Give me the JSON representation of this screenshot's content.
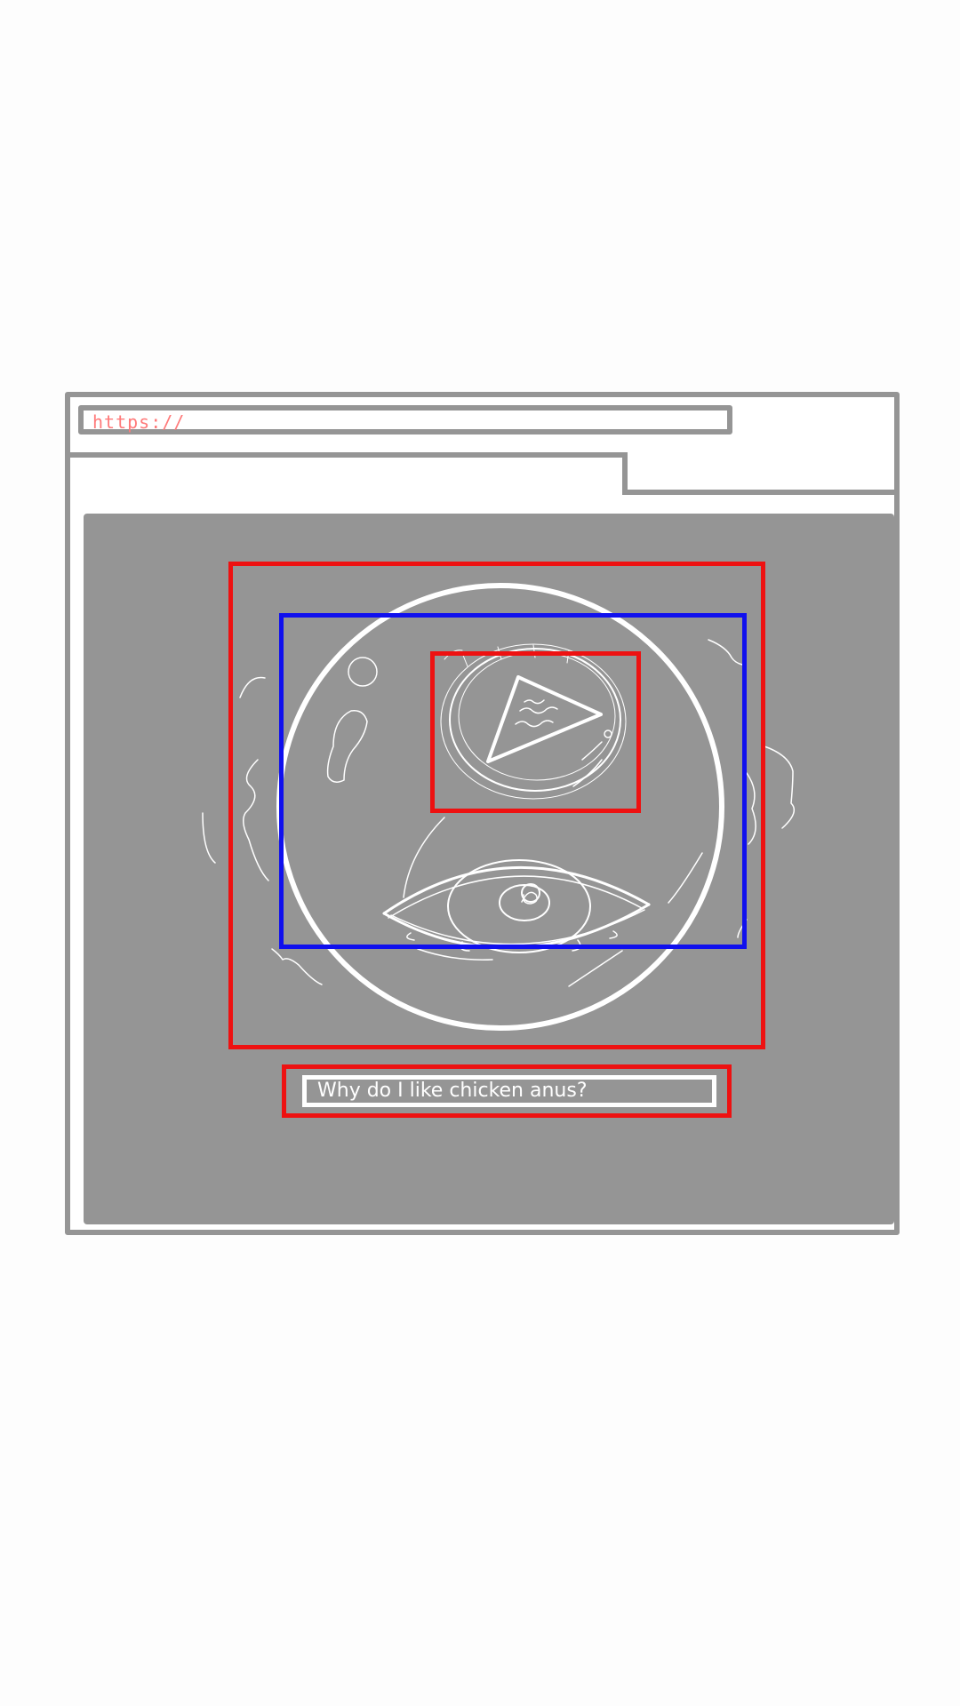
{
  "browser": {
    "address_bar": {
      "value": "https://"
    }
  },
  "search": {
    "query": "Why do I like chicken anus?"
  },
  "colors": {
    "frame": "#959595",
    "content_background": "#959595",
    "highlight_red": "#ee1111",
    "highlight_blue": "#1010ee",
    "url_text": "#ff7a7a",
    "sketch_lines": "#ffffff"
  },
  "icons": {
    "play": "play-triangle",
    "eye": "eye"
  }
}
